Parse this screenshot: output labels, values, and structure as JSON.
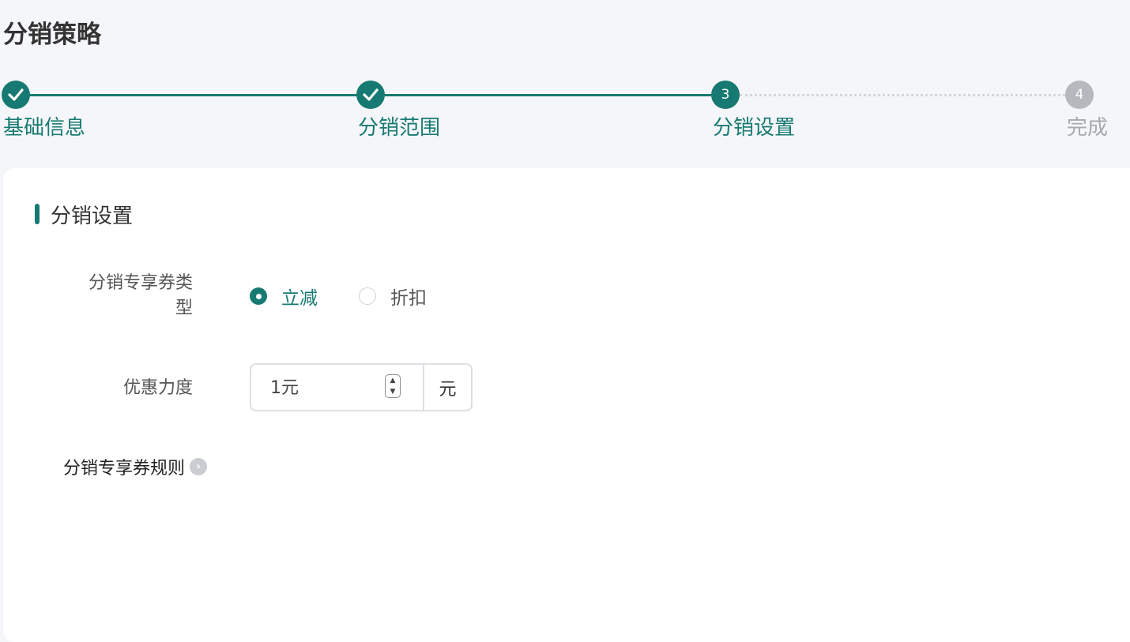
{
  "page": {
    "title": "分销策略"
  },
  "steps": [
    {
      "label": "基础信息",
      "status": "done",
      "number": ""
    },
    {
      "label": "分销范围",
      "status": "done",
      "number": ""
    },
    {
      "label": "分销设置",
      "status": "active",
      "number": "3"
    },
    {
      "label": "完成",
      "status": "todo",
      "number": "4"
    }
  ],
  "colors": {
    "accent": "#177a72",
    "inactive": "#b5b8bd"
  },
  "section": {
    "title": "分销设置"
  },
  "form": {
    "coupon_type": {
      "label_line1": "分销专享券类",
      "label_line2": "型",
      "options": [
        "立减",
        "折扣"
      ],
      "selected": "立减"
    },
    "discount": {
      "label": "优惠力度",
      "value": "1元",
      "suffix": "元"
    },
    "rule_link": {
      "label": "分销专享券规则",
      "icon": "chevron-right-icon"
    }
  },
  "icons": {
    "check": "check-icon",
    "spinner": "number-spinner-icon"
  }
}
